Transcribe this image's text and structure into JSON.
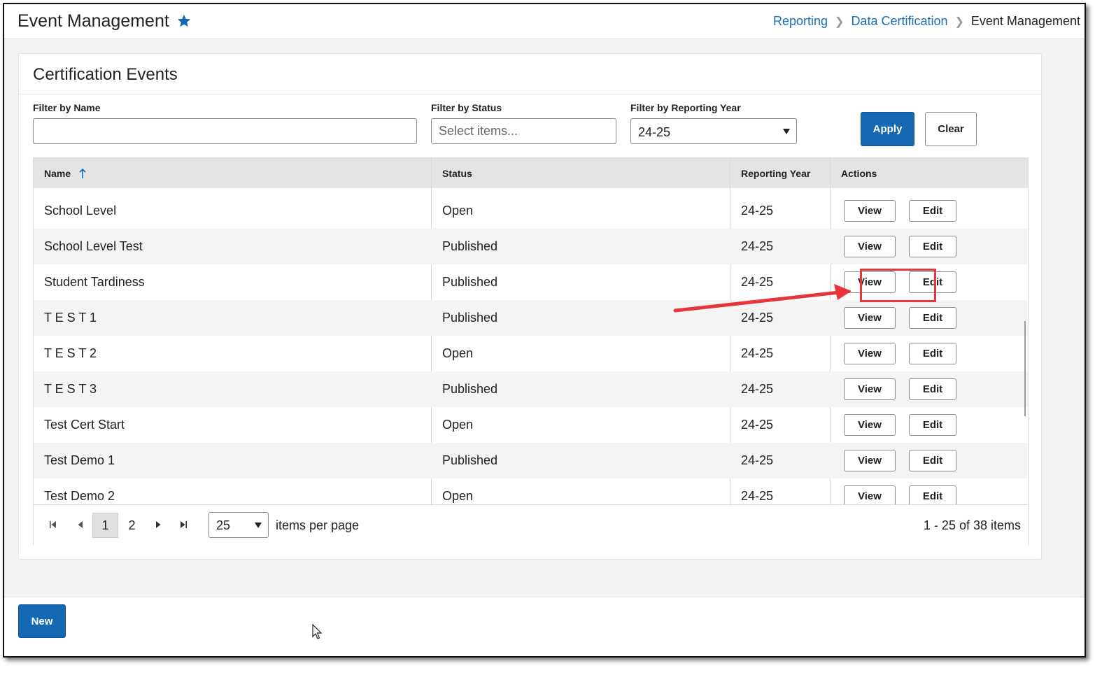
{
  "header": {
    "title": "Event Management",
    "favorite_icon": "star-icon",
    "breadcrumb": [
      "Reporting",
      "Data Certification",
      "Event Management"
    ]
  },
  "card": {
    "title": "Certification Events"
  },
  "filters": {
    "name_label": "Filter by Name",
    "name_value": "",
    "status_label": "Filter by Status",
    "status_placeholder": "Select items...",
    "year_label": "Filter by Reporting Year",
    "year_value": "24-25",
    "apply_label": "Apply",
    "clear_label": "Clear"
  },
  "table": {
    "columns": [
      "Name",
      "Status",
      "Reporting Year",
      "Actions"
    ],
    "sort": {
      "column": "Name",
      "direction": "ascending",
      "icon": "arrow-up-icon"
    },
    "view_label": "View",
    "edit_label": "Edit",
    "rows": [
      {
        "name": "School Level",
        "status": "Open",
        "year": "24-25"
      },
      {
        "name": "School Level Test",
        "status": "Published",
        "year": "24-25"
      },
      {
        "name": "Student Tardiness",
        "status": "Published",
        "year": "24-25"
      },
      {
        "name": "T E S T 1",
        "status": "Published",
        "year": "24-25"
      },
      {
        "name": "T E S T 2",
        "status": "Open",
        "year": "24-25"
      },
      {
        "name": "T E S T 3",
        "status": "Published",
        "year": "24-25"
      },
      {
        "name": "Test Cert Start",
        "status": "Open",
        "year": "24-25"
      },
      {
        "name": "Test Demo 1",
        "status": "Published",
        "year": "24-25"
      },
      {
        "name": "Test Demo 2",
        "status": "Open",
        "year": "24-25"
      }
    ]
  },
  "pager": {
    "pages": [
      "1",
      "2"
    ],
    "current_page": "1",
    "page_size": "25",
    "items_per_page_label": "items per page",
    "summary": "1 - 25 of 38 items"
  },
  "footer": {
    "new_label": "New"
  },
  "annotation": {
    "highlight_color": "#e8353b",
    "highlighted_row": "Student Tardiness",
    "highlighted_button": "View"
  },
  "colors": {
    "primary": "#1569b3",
    "link": "#1a6fb8"
  }
}
